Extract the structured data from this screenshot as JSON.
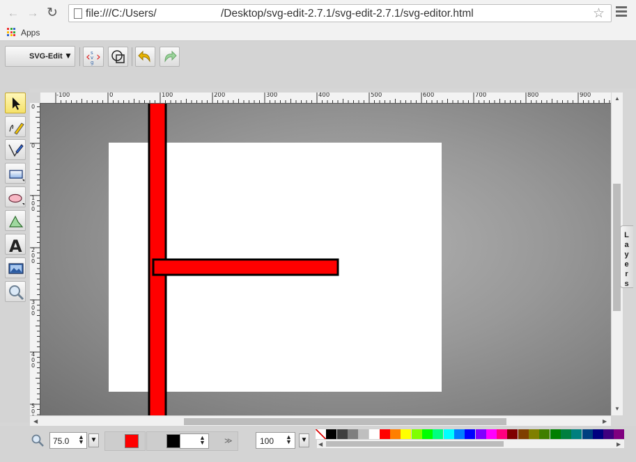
{
  "browser": {
    "url_prefix": "file:///C:/Users/",
    "url_suffix": "/Desktop/svg-edit-2.7.1/svg-edit-2.7.1/svg-editor.html",
    "apps_label": "Apps"
  },
  "toolbar": {
    "main_menu_label": "SVG-Edit",
    "main_menu_arrow": "▼"
  },
  "rulers": {
    "x_labels": [
      "-100",
      "0",
      "100",
      "200",
      "300",
      "400",
      "500",
      "600",
      "700",
      "800",
      "900"
    ],
    "y_labels": [
      "0",
      "0",
      "100",
      "200",
      "300",
      "400",
      "500"
    ]
  },
  "layers_label": "Layers",
  "bottom": {
    "zoom_value": "75.0",
    "stroke_width_value": "100",
    "fill_color": "#ff0000",
    "stroke_color": "#000000",
    "more_label": "≫"
  },
  "palette": [
    "none",
    "#000000",
    "#3f3f3f",
    "#7f7f7f",
    "#bfbfbf",
    "#ffffff",
    "#ff0000",
    "#ff7f00",
    "#ffff00",
    "#7fff00",
    "#00ff00",
    "#00ff7f",
    "#00ffff",
    "#007fff",
    "#0000ff",
    "#7f00ff",
    "#ff00ff",
    "#ff007f",
    "#7f0000",
    "#7f3f00",
    "#7f7f00",
    "#3f7f00",
    "#007f00",
    "#007f3f",
    "#007f7f",
    "#003f7f",
    "#00007f",
    "#3f007f",
    "#7f007f"
  ],
  "colors": {
    "shape_fill": "#ff0000",
    "shape_stroke": "#000000"
  }
}
